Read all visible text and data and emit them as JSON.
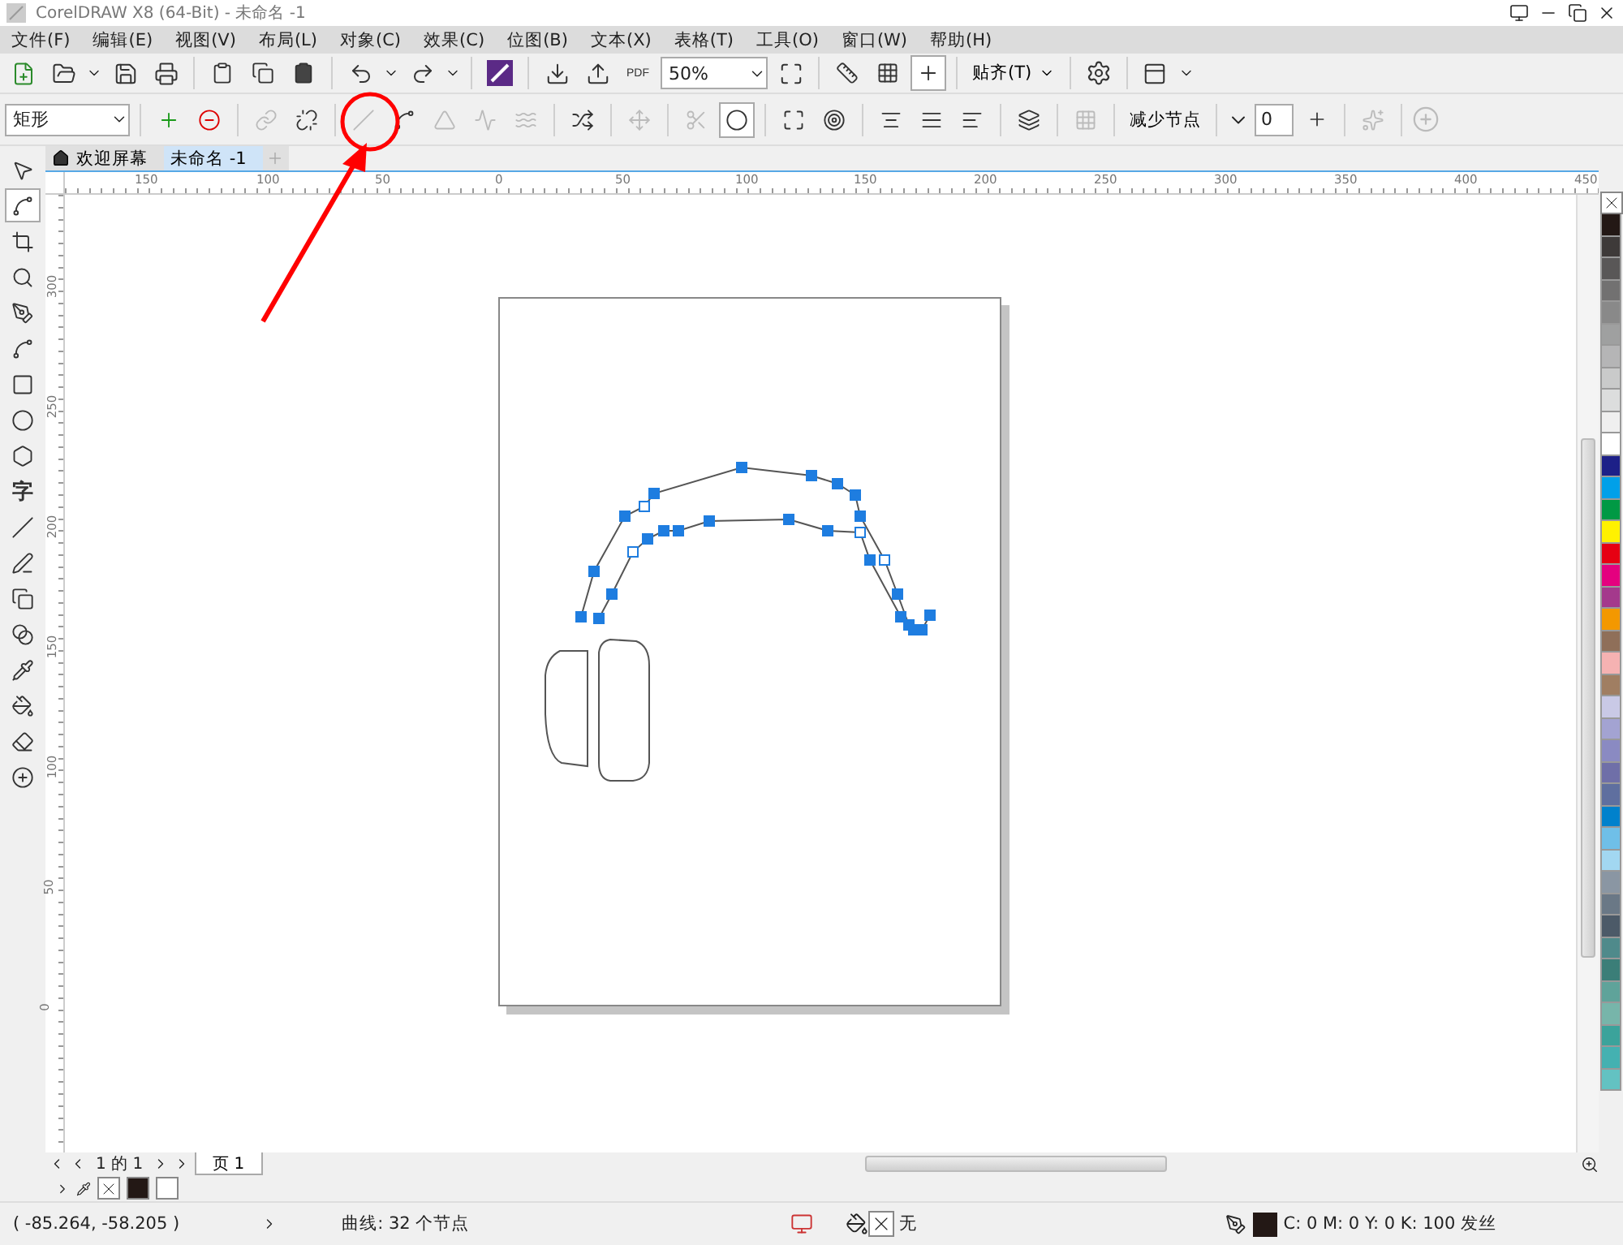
{
  "window": {
    "title": "CorelDRAW X8 (64-Bit) - 未命名 -1"
  },
  "menu": [
    "文件(F)",
    "编辑(E)",
    "视图(V)",
    "布局(L)",
    "对象(C)",
    "效果(C)",
    "位图(B)",
    "文本(X)",
    "表格(T)",
    "工具(O)",
    "窗口(W)",
    "帮助(H)"
  ],
  "standard_toolbar": {
    "pdf_label": "PDF",
    "zoom": "50%",
    "snap": "贴齐(T)",
    "view_toggles": [
      {
        "selected": false
      },
      {
        "selected": false
      },
      {
        "selected": true
      }
    ]
  },
  "property_bar": {
    "object_type": "矩形",
    "reduce_nodes": "减少节点",
    "smoothness": "0",
    "buttons": [
      {
        "disabled": false,
        "selected": false
      },
      {
        "disabled": false,
        "selected": false
      },
      {
        "disabled": true,
        "selected": false
      },
      {
        "disabled": false,
        "selected": false
      },
      {
        "disabled": true,
        "selected": false
      },
      {
        "disabled": false,
        "selected": false
      },
      {
        "disabled": true,
        "selected": false
      },
      {
        "disabled": true,
        "selected": false
      },
      {
        "disabled": true,
        "selected": false
      },
      {
        "disabled": false,
        "selected": false
      },
      {
        "disabled": true,
        "selected": false
      },
      {
        "disabled": true,
        "selected": false
      },
      {
        "disabled": false,
        "selected": true
      },
      {
        "disabled": false,
        "selected": false
      },
      {
        "disabled": false,
        "selected": false
      },
      {
        "disabled": false,
        "selected": false
      },
      {
        "disabled": false,
        "selected": false
      },
      {
        "disabled": false,
        "selected": false
      },
      {
        "disabled": false,
        "selected": false
      },
      {
        "disabled": true,
        "selected": false
      },
      {
        "disabled": true,
        "selected": false
      }
    ]
  },
  "toolbox": [
    {
      "selected": false
    },
    {
      "selected": true
    },
    {
      "selected": false
    },
    {
      "selected": false
    },
    {
      "selected": false
    },
    {
      "selected": false
    },
    {
      "selected": false
    },
    {
      "selected": false
    },
    {
      "selected": false
    },
    {
      "label": "字",
      "selected": false
    },
    {
      "selected": false
    },
    {
      "selected": false
    },
    {
      "selected": false
    },
    {
      "selected": false
    },
    {
      "selected": false
    },
    {
      "selected": false
    },
    {
      "selected": false
    },
    {
      "selected": false
    }
  ],
  "tabs": [
    {
      "label": "欢迎屏幕",
      "selected": false
    },
    {
      "label": "未命名 -1",
      "selected": true
    }
  ],
  "horizontal_ruler": [
    "150",
    "100",
    "50",
    "0",
    "50",
    "100",
    "150",
    "200",
    "250",
    "300",
    "350",
    "400",
    "450"
  ],
  "vertical_ruler": [
    "300",
    "250",
    "200",
    "150",
    "100",
    "50",
    "0"
  ],
  "page_nav": {
    "counter": "1 的 1",
    "page_tab": "页 1"
  },
  "palette": [
    {
      "color": "#231815"
    },
    {
      "color": "#3e3a39"
    },
    {
      "color": "#595757"
    },
    {
      "color": "#727171"
    },
    {
      "color": "#898989"
    },
    {
      "color": "#9fa0a0"
    },
    {
      "color": "#b5b5b6"
    },
    {
      "color": "#c9caca"
    },
    {
      "color": "#dcdddd"
    },
    {
      "color": "#efefef"
    },
    {
      "color": "#ffffff"
    },
    {
      "color": "#1d2088"
    },
    {
      "color": "#00a0e9"
    },
    {
      "color": "#009944"
    },
    {
      "color": "#fff100"
    },
    {
      "color": "#e60012"
    },
    {
      "color": "#e4007f"
    },
    {
      "color": "#a4398c"
    },
    {
      "color": "#f39800"
    },
    {
      "color": "#8f6f59"
    },
    {
      "color": "#f5b2b2"
    },
    {
      "color": "#a07e62"
    },
    {
      "color": "#c9c9e6"
    },
    {
      "color": "#a3a3d2"
    },
    {
      "color": "#8a8ac2"
    },
    {
      "color": "#6f6fa8"
    },
    {
      "color": "#5f6f9f"
    },
    {
      "color": "#0081cc"
    },
    {
      "color": "#6fbfe8"
    },
    {
      "color": "#a2d7f1"
    },
    {
      "color": "#8a96a3"
    },
    {
      "color": "#6a7886"
    },
    {
      "color": "#4c5a68"
    },
    {
      "color": "#4f8a8b"
    },
    {
      "color": "#3b7e78"
    },
    {
      "color": "#5fa39a"
    },
    {
      "color": "#77b5aa"
    },
    {
      "color": "#3ba39b"
    },
    {
      "color": "#44b1b1"
    },
    {
      "color": "#63c2c2"
    }
  ],
  "document_colors": [
    {
      "color": "#231815"
    },
    {
      "color": "#ffffff"
    }
  ],
  "status_bar": {
    "coordinates": "( -85.264, -58.205 )",
    "selection": "曲线: 32 个节点",
    "fill": "无",
    "outline": "C: 0 M: 0 Y: 0 K: 100 发丝"
  }
}
